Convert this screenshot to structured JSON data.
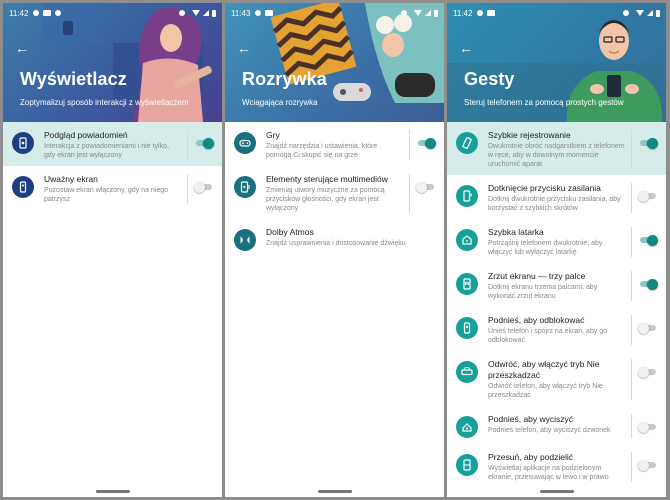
{
  "screens": [
    {
      "status_time": "11:42",
      "title": "Wyświetlacz",
      "subtitle": "Zoptymalizuj sposób interakcji z wyświetlaczem",
      "items": [
        {
          "title": "Podgląd powiadomień",
          "desc": "Interakcja z powiadomieniami i nie tylko, gdy ekran jest wyłączony",
          "on": true,
          "highlight": true
        },
        {
          "title": "Uważny ekran",
          "desc": "Pozostaw ekran włączony, gdy na niego patrzysz",
          "on": false,
          "highlight": false
        }
      ]
    },
    {
      "status_time": "11:43",
      "title": "Rozrywka",
      "subtitle": "Wciągająca rozrywka",
      "items": [
        {
          "title": "Gry",
          "desc": "Znajdź narzędzia i ustawienia, które pomogą Ci skupić się na grze",
          "on": true
        },
        {
          "title": "Elementy sterujące multimediów",
          "desc": "Zmieniaj utwory muzyczne za pomocą przycisków głośności, gdy ekran jest wyłączony",
          "on": false
        },
        {
          "title": "Dolby Atmos",
          "desc": "Znajdź usprawnienia i dostosowanie dźwięku"
        }
      ]
    },
    {
      "status_time": "11:42",
      "title": "Gesty",
      "subtitle": "Steruj telefonem za pomocą prostych gestów",
      "items": [
        {
          "title": "Szybkie rejestrowanie",
          "desc": "Dwukrotnie obróć nadgarstkiem z telefonem w ręce, aby w dowolnym momencie uruchomić aparat",
          "on": true,
          "highlight": true
        },
        {
          "title": "Dotknięcie przycisku zasilania",
          "desc": "Dotknij dwukrotnie przycisku zasilania, aby korzystać z szybkich skrótów",
          "on": false
        },
        {
          "title": "Szybka latarka",
          "desc": "Potrząśnij telefonem dwukrotnie, aby włączyć lub wyłączyć latarkę",
          "on": true
        },
        {
          "title": "Zrzut ekranu — trzy palce",
          "desc": "Dotknij ekranu trzema palcami, aby wykonać zrzut ekranu",
          "on": true
        },
        {
          "title": "Podnieś, aby odblokować",
          "desc": "Unieś telefon i spójrz na ekran, aby go odblokować",
          "on": false
        },
        {
          "title": "Odwróć, aby włączyć tryb Nie przeszkadzać",
          "desc": "Odwróć telefon, aby włączyć tryb Nie przeszkadzać",
          "on": false
        },
        {
          "title": "Podnieś, aby wyciszyć",
          "desc": "Podnieś telefon, aby wyciszyć dzwonek",
          "on": false
        },
        {
          "title": "Przesuń, aby podzielić",
          "desc": "Wyświetlaj aplikacje na podzielonym ekranie, przesuwając w lewo i w prawo",
          "on": false
        }
      ]
    }
  ],
  "colors": {
    "accent": "#0f8a80",
    "highlight": "#d5ecea",
    "icon_dark": "#1c3f82",
    "icon_teal": "#16a099",
    "icon_game": "#1a6f80"
  }
}
